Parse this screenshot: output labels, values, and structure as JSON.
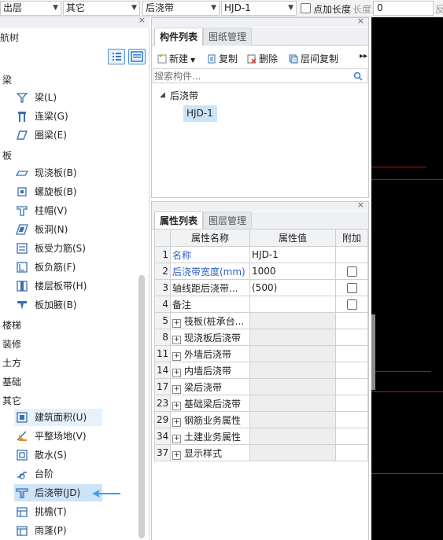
{
  "toolbar": {
    "floor_select": "出层",
    "category_select": "其它",
    "component_type_select": "后浇带",
    "component_select": "HJD-1",
    "point_length_label": "点加长度",
    "length_label": "长度:",
    "length_value": "0",
    "cut_off": "反"
  },
  "nav": {
    "title": "航树",
    "groups": [
      {
        "label": "梁",
        "items": [
          {
            "label": "梁(L)",
            "icon": "beam-icon"
          },
          {
            "label": "连梁(G)",
            "icon": "coupling-beam-icon"
          },
          {
            "label": "圈梁(E)",
            "icon": "ring-beam-icon"
          }
        ]
      },
      {
        "label": "板",
        "items": [
          {
            "label": "现浇板(B)",
            "icon": "cast-slab-icon"
          },
          {
            "label": "螺旋板(B)",
            "icon": "spiral-slab-icon"
          },
          {
            "label": "柱帽(V)",
            "icon": "column-cap-icon"
          },
          {
            "label": "板洞(N)",
            "icon": "slab-hole-icon"
          },
          {
            "label": "板受力筋(S)",
            "icon": "slab-rebar-icon"
          },
          {
            "label": "板负筋(F)",
            "icon": "negative-rebar-icon"
          },
          {
            "label": "楼层板带(H)",
            "icon": "slab-strip-icon"
          },
          {
            "label": "板加腋(B)",
            "icon": "slab-haunch-icon"
          }
        ]
      },
      {
        "label": "楼梯",
        "items": []
      },
      {
        "label": "装修",
        "items": []
      },
      {
        "label": "土方",
        "items": []
      },
      {
        "label": "基础",
        "items": []
      },
      {
        "label": "其它",
        "items": [
          {
            "label": "建筑面积(U)",
            "icon": "building-area-icon"
          },
          {
            "label": "平整场地(V)",
            "icon": "site-leveling-icon"
          },
          {
            "label": "散水(S)",
            "icon": "apron-icon"
          },
          {
            "label": "台阶",
            "icon": "steps-icon"
          },
          {
            "label": "后浇带(JD)",
            "icon": "post-cast-strip-icon"
          },
          {
            "label": "挑檐(T)",
            "icon": "eave-icon"
          },
          {
            "label": "雨蓬(P)",
            "icon": "canopy-icon"
          }
        ]
      }
    ]
  },
  "component_panel": {
    "tabs": [
      "构件列表",
      "图纸管理"
    ],
    "buttons": {
      "new": "新建",
      "copy": "复制",
      "delete": "删除",
      "floor_copy": "层间复制"
    },
    "search_placeholder": "搜索构件...",
    "tree_root": "后浇带",
    "tree_child": "HJD-1"
  },
  "property_panel": {
    "tabs": [
      "属性列表",
      "图层管理"
    ],
    "columns": [
      "属性名称",
      "属性值",
      "附加"
    ],
    "rows": [
      {
        "num": "1",
        "name": "名称",
        "value": "HJD-1"
      },
      {
        "num": "2",
        "name": "后浇带宽度(mm)",
        "value": "1000"
      },
      {
        "num": "3",
        "name": "轴线距后浇带...",
        "value": "(500)"
      },
      {
        "num": "4",
        "name": "备注",
        "value": ""
      },
      {
        "num": "5",
        "name": "筏板(桩承台...",
        "value": ""
      },
      {
        "num": "8",
        "name": "现浇板后浇带",
        "value": ""
      },
      {
        "num": "11",
        "name": "外墙后浇带",
        "value": ""
      },
      {
        "num": "14",
        "name": "内墙后浇带",
        "value": ""
      },
      {
        "num": "17",
        "name": "梁后浇带",
        "value": ""
      },
      {
        "num": "23",
        "name": "基础梁后浇带",
        "value": ""
      },
      {
        "num": "29",
        "name": "钢筋业务属性",
        "value": ""
      },
      {
        "num": "34",
        "name": "土建业务属性",
        "value": ""
      },
      {
        "num": "37",
        "name": "显示样式",
        "value": ""
      }
    ]
  },
  "colors": {
    "accent": "#2d61c8",
    "selection": "#cde3f7",
    "arrow": "#3aa0e8",
    "canvas": "#000000",
    "axis_line": "#b01515"
  }
}
